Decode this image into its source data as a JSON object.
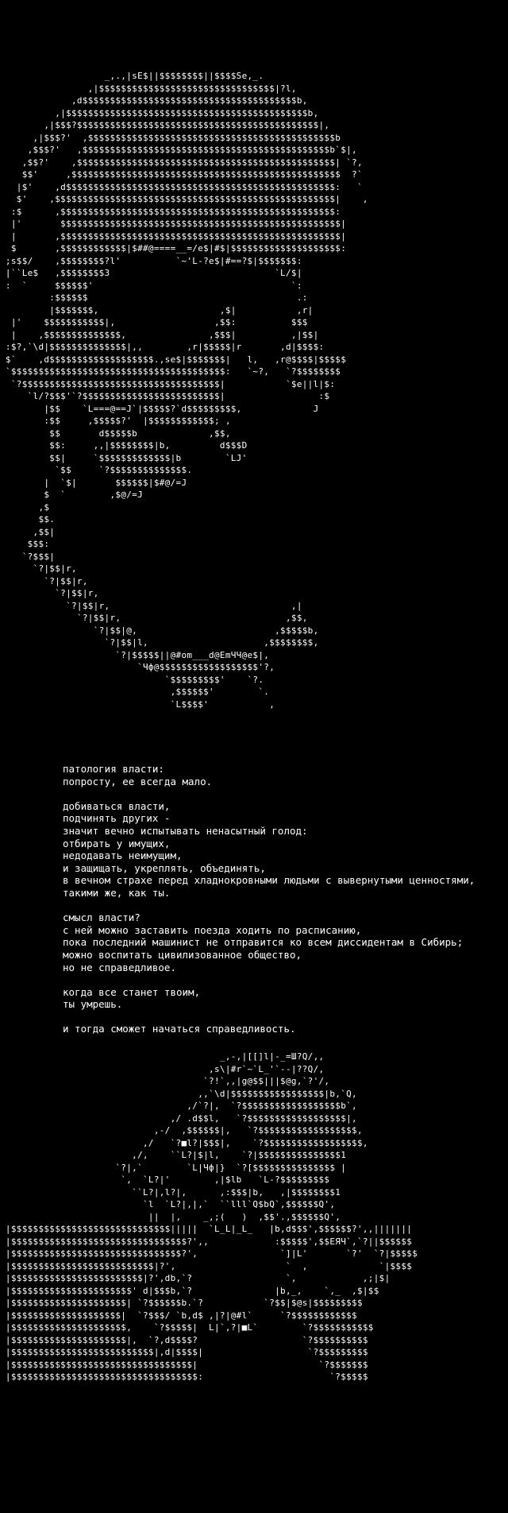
{
  "colors": {
    "background": "#000000",
    "foreground": "#ffffff"
  },
  "portrait_art": "                   _,.,|sE$||$$$$$$$$||$$$$Se,_.\n                ,|$$$$$$$$$$$$$$$$$$$$$$$$$$$$$$$$|?l,\n             ,d$$$$$$$$$$$$$$$$$$$$$$$$$$$$$$$$$$$$$$$b,\n          ,|$$$$$$$$$$$$$$$$$$$$$$$$$$$$$$$$$$$$$$$$$$$$b,\n        ,|$$$?$$$$$$$$$$$$$$$$$$$$$$$$$$$$$$$$$$$$$$$$$$$$|,\n      ,|$$$?'  ,$$$$$$$$$$$$$$$$$$$$$$$$$$$$$$$$$$$$$$$$$$$$$b\n     ,$$$?'   ,$$$$$$$$$$$$$$$$$$$$$$$$$$$$$$$$$$$$$$$$$$$$$b`$|,\n    ,$$?'    ,$$$$$$$$$$$$$$$$$$$$$$$$$$$$$$$$$$$$$$$$$$$$$$$| `?,\n    $$'     ,$$$$$$$$$$$$$$$$$$$$$$$$$$$$$$$$$$$$$$$$$$$$$$$$$  ?`\n   |$'    ,d$$$$$$$$$$$$$$$$$$$$$$$$$$$$$$$$$$$$$$$$$$$$$$$$$:   `\n   $'    ,$$$$$$$$$$$$$$$$$$$$$$$$$$$$$$$$$$$$$$$$$$$$$$$$$$$|    ,\n  :$      ,$$$$$$$$$$$$$$$$$$$$$$$$$$$$$$$$$$$$$$$$$$$$$$$$$$:\n  |'       $$$$$$$$$$$$$$$$$$$$$$$$$$$$$$$$$$$$$$$$$$$$$$$$$$$|\n  |       ,$$$$$$$$$$$$$$$$$$$$$$$$$$$$$$$$$$$$$$$$$$$$$$$$$$$|\n  $       ,$$$$$$$$$$$$|$##@====__=/e$|#$|$$$$$$$$$$$$$$$$$$$$:\n ;s$$/    ,$$$$$$$$?l'          `~'L-?e$|#==?$|$$$$$$$:\n |``Le$   ,$$$$$$$$3                              `L/$|\n :  `     $$$$$$'                                    `:\n         :$$$$$$                                      .:\n         |$$$$$$$,                      ,$|           ,r|\n  |'    $$$$$$$$$$$|,                  ,$$:          $$$\n  |    ,$$$$$$$$$$$$$$,               ,$$$|          ,|$$|\n :$?,`\\d|$$$$$$$$$$$$$$|,,        ,r|$$$$$|r       ,d|$$$$:\n $`    ,d$$$$$$$$$$$$$$$$$$$.,se$|$$$$$$$|   l,   ,r@$$$$|$$$$$\n `$$$$$$$$$$$$$$$$$$$$$$$$$$$$$$$$$$$$$$$:   `~?,   `?$$$$$$$$\n  `?$$$$$$$$$$$$$$$$$$$$$$$$$$$$$$$$$$$$|           `$e||l|$:\n     `l/?$$$'`?$$$$$$$$$$$$$$$$$$$$$$$$$|                 :$\n        |$$    `L===@==J`|$$$$$?`d$$$$$$$$$,             J\n        :$$     ,$$$$$?'  |$$$$$$$$$$$$; ,\n         $$       d$$$$$b             ,$$,\n         $$:     ,,|$$$$$$$$|b,         d$$$D\n         $$|     `$$$$$$$$$$$$$|b        `LJ'\n          `$$     `?$$$$$$$$$$$$$$.\n        |  `$|       $$$$$$|$#@/=J\n        $  `        ,$@/=J\n       ,$\n       $$.\n      ,$$|\n     $$$:\n    `?$$$|\n      `?|$$|r,\n        `?|$$|r,\n          `?|$$|r,\n            `?|$$|r,                                 ,|\n              `?|$$|r,                              ,$$,\n                 `?|$$|@,                         ,$$$$$b,\n                   `?|$$|l,                     ,$$$$$$$$,\n                     `?|$$$$$||@#om___d@EmЧЧ@e$|,\n                         `Чф@$$$$$$$$$$$$$$$$$$'?,\n                              `$$$$$$$$$'    `?.\n                               ,$$$$$$'        `.\n                               `L$$$$'           ,",
  "poem": {
    "stanzas": [
      [
        "патология власти:",
        "попросту, ее всегда мало."
      ],
      [
        "добиваться власти,",
        "подчинять других -",
        "значит вечно испытывать ненасытный голод:",
        "отбирать у имущих,",
        "недодавать неимущим,",
        "и защищать, укреплять, объединять,",
        "в вечном страхе перед хладнокровными людьми с вывернутыми ценностями,",
        "такими же, как ты."
      ],
      [
        "смысл власти?",
        "с ней можно заставить поезда ходить по расписанию,",
        "пока последний машинист не отправится ко всем диссидентам в Сибирь;",
        "можно воспитать цивилизованное общество,",
        "но не справедливое."
      ],
      [
        "когда все станет твоим,",
        "ты умрешь."
      ],
      [
        "и тогда сможет начаться справедливость."
      ]
    ]
  },
  "hand_art": "                                        _,-,|[[]l|-_=Ш?Q/,,\n                                      ,s\\|#r`~`L_'`--|??Q/,\n                                     `?!`,,|g@$$|||$@g,`?'/,\n                                    ,,`\\d|$$$$$$$$$$$$$$$$$|b,`Q,\n                                  ,/`?|,  `?$$$$$$$$$$$$$$$$$$b`,\n                               ,/ .d$$l,   `?$$$$$$$$$$$$$$$$$$|,\n                            ,-/  ,$$$$$$|,   `?$$$$$$$$$$$$$$$$$$,\n                          ,/   `?■l?|$$$|,    `?$$$$$$$$$$$$$$$$$$,\n                        ,/,    ``L?|$|l,    `?|$$$$$$$$$$$$$$$1\n                     `?|,`        `L|Чф|}  `?[$$$$$$$$$$$$$$$ |\n                      `,  `L?|'        ,|$lb   `L-?$$$$$$$$$\n                        ``L?|,l?|,      ,:$$$|b,   ,|$$$$$$$$1\n                          `l  `L?|,|,`  ``lll`Q$bQ`,$$$$$$Q',\n                           ||  |,    _,;(   )  ,$$'.,$$$$$$Q',\n |$$$$$$$$$$$$$$$$$$$$$$$$$$$$$|||||  `L_L|_L_   |b,d$$$',$$$$$$?',,|||||||\n |$$$$$$$$$$$$$$$$$$$$$$$$$$$$$$$$?',,            :$$$$$',$$EЯЧ`,`?||$$$$$$\n |$$$$$$$$$$$$$$$$$$$$$$$$$$$$$$$?',               `]|L'       `?'  `?|$$$$$\n |$$$$$$$$$$$$$$$$$$$$$$$$$$|?',                    `  ,             `|$$$$\n |$$$$$$$$$$$$$$$$$$$$$$$$|?',db,`?                 `,            ,;|$|\n |$$$$$$$$$$$$$$$$$$$$$$' d|$$$b,`?               |b,_,    `,_  ,$|$$\n |$$$$$$$$$$$$$$$$$$$$$| `?$$$$$$b.`?           `?$$|$@s|$$$$$$$$$\n |$$$$$$$$$$$$$$$$$$$$|  `?$$$/ `b,d$ ,|?|@#l`     `?$$$$$$$$$$$$\n |$$$$$$$$$$$$$$$$$$$$$,    `?$$$$$|  L|`,?|■L`        `?$$$$$$$$$$$\n |$$$$$$$$$$$$$$$$$$$$$|,  `?,d$$$$?                   `?$$$$$$$$$$\n |$$$$$$$$$$$$$$$$$$$$$$$$$$|,d|$$$$|                   `?$$$$$$$$$\n |$$$$$$$$$$$$$$$$$$$$$$$$$$$$$$$$$|                      `?$$$$$$$\n |$$$$$$$$$$$$$$$$$$$$$$$$$$$$$$$$$$:                       `?$$$$$"
}
